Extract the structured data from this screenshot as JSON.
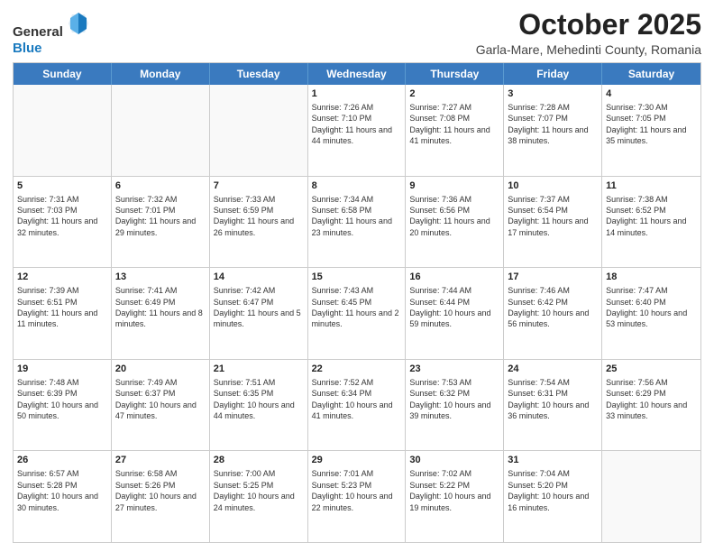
{
  "header": {
    "logo": {
      "line1": "General",
      "line2": "Blue"
    },
    "title": "October 2025",
    "location": "Garla-Mare, Mehedinti County, Romania"
  },
  "weekdays": [
    "Sunday",
    "Monday",
    "Tuesday",
    "Wednesday",
    "Thursday",
    "Friday",
    "Saturday"
  ],
  "rows": [
    [
      {
        "day": "",
        "sunrise": "",
        "sunset": "",
        "daylight": ""
      },
      {
        "day": "",
        "sunrise": "",
        "sunset": "",
        "daylight": ""
      },
      {
        "day": "",
        "sunrise": "",
        "sunset": "",
        "daylight": ""
      },
      {
        "day": "1",
        "sunrise": "Sunrise: 7:26 AM",
        "sunset": "Sunset: 7:10 PM",
        "daylight": "Daylight: 11 hours and 44 minutes."
      },
      {
        "day": "2",
        "sunrise": "Sunrise: 7:27 AM",
        "sunset": "Sunset: 7:08 PM",
        "daylight": "Daylight: 11 hours and 41 minutes."
      },
      {
        "day": "3",
        "sunrise": "Sunrise: 7:28 AM",
        "sunset": "Sunset: 7:07 PM",
        "daylight": "Daylight: 11 hours and 38 minutes."
      },
      {
        "day": "4",
        "sunrise": "Sunrise: 7:30 AM",
        "sunset": "Sunset: 7:05 PM",
        "daylight": "Daylight: 11 hours and 35 minutes."
      }
    ],
    [
      {
        "day": "5",
        "sunrise": "Sunrise: 7:31 AM",
        "sunset": "Sunset: 7:03 PM",
        "daylight": "Daylight: 11 hours and 32 minutes."
      },
      {
        "day": "6",
        "sunrise": "Sunrise: 7:32 AM",
        "sunset": "Sunset: 7:01 PM",
        "daylight": "Daylight: 11 hours and 29 minutes."
      },
      {
        "day": "7",
        "sunrise": "Sunrise: 7:33 AM",
        "sunset": "Sunset: 6:59 PM",
        "daylight": "Daylight: 11 hours and 26 minutes."
      },
      {
        "day": "8",
        "sunrise": "Sunrise: 7:34 AM",
        "sunset": "Sunset: 6:58 PM",
        "daylight": "Daylight: 11 hours and 23 minutes."
      },
      {
        "day": "9",
        "sunrise": "Sunrise: 7:36 AM",
        "sunset": "Sunset: 6:56 PM",
        "daylight": "Daylight: 11 hours and 20 minutes."
      },
      {
        "day": "10",
        "sunrise": "Sunrise: 7:37 AM",
        "sunset": "Sunset: 6:54 PM",
        "daylight": "Daylight: 11 hours and 17 minutes."
      },
      {
        "day": "11",
        "sunrise": "Sunrise: 7:38 AM",
        "sunset": "Sunset: 6:52 PM",
        "daylight": "Daylight: 11 hours and 14 minutes."
      }
    ],
    [
      {
        "day": "12",
        "sunrise": "Sunrise: 7:39 AM",
        "sunset": "Sunset: 6:51 PM",
        "daylight": "Daylight: 11 hours and 11 minutes."
      },
      {
        "day": "13",
        "sunrise": "Sunrise: 7:41 AM",
        "sunset": "Sunset: 6:49 PM",
        "daylight": "Daylight: 11 hours and 8 minutes."
      },
      {
        "day": "14",
        "sunrise": "Sunrise: 7:42 AM",
        "sunset": "Sunset: 6:47 PM",
        "daylight": "Daylight: 11 hours and 5 minutes."
      },
      {
        "day": "15",
        "sunrise": "Sunrise: 7:43 AM",
        "sunset": "Sunset: 6:45 PM",
        "daylight": "Daylight: 11 hours and 2 minutes."
      },
      {
        "day": "16",
        "sunrise": "Sunrise: 7:44 AM",
        "sunset": "Sunset: 6:44 PM",
        "daylight": "Daylight: 10 hours and 59 minutes."
      },
      {
        "day": "17",
        "sunrise": "Sunrise: 7:46 AM",
        "sunset": "Sunset: 6:42 PM",
        "daylight": "Daylight: 10 hours and 56 minutes."
      },
      {
        "day": "18",
        "sunrise": "Sunrise: 7:47 AM",
        "sunset": "Sunset: 6:40 PM",
        "daylight": "Daylight: 10 hours and 53 minutes."
      }
    ],
    [
      {
        "day": "19",
        "sunrise": "Sunrise: 7:48 AM",
        "sunset": "Sunset: 6:39 PM",
        "daylight": "Daylight: 10 hours and 50 minutes."
      },
      {
        "day": "20",
        "sunrise": "Sunrise: 7:49 AM",
        "sunset": "Sunset: 6:37 PM",
        "daylight": "Daylight: 10 hours and 47 minutes."
      },
      {
        "day": "21",
        "sunrise": "Sunrise: 7:51 AM",
        "sunset": "Sunset: 6:35 PM",
        "daylight": "Daylight: 10 hours and 44 minutes."
      },
      {
        "day": "22",
        "sunrise": "Sunrise: 7:52 AM",
        "sunset": "Sunset: 6:34 PM",
        "daylight": "Daylight: 10 hours and 41 minutes."
      },
      {
        "day": "23",
        "sunrise": "Sunrise: 7:53 AM",
        "sunset": "Sunset: 6:32 PM",
        "daylight": "Daylight: 10 hours and 39 minutes."
      },
      {
        "day": "24",
        "sunrise": "Sunrise: 7:54 AM",
        "sunset": "Sunset: 6:31 PM",
        "daylight": "Daylight: 10 hours and 36 minutes."
      },
      {
        "day": "25",
        "sunrise": "Sunrise: 7:56 AM",
        "sunset": "Sunset: 6:29 PM",
        "daylight": "Daylight: 10 hours and 33 minutes."
      }
    ],
    [
      {
        "day": "26",
        "sunrise": "Sunrise: 6:57 AM",
        "sunset": "Sunset: 5:28 PM",
        "daylight": "Daylight: 10 hours and 30 minutes."
      },
      {
        "day": "27",
        "sunrise": "Sunrise: 6:58 AM",
        "sunset": "Sunset: 5:26 PM",
        "daylight": "Daylight: 10 hours and 27 minutes."
      },
      {
        "day": "28",
        "sunrise": "Sunrise: 7:00 AM",
        "sunset": "Sunset: 5:25 PM",
        "daylight": "Daylight: 10 hours and 24 minutes."
      },
      {
        "day": "29",
        "sunrise": "Sunrise: 7:01 AM",
        "sunset": "Sunset: 5:23 PM",
        "daylight": "Daylight: 10 hours and 22 minutes."
      },
      {
        "day": "30",
        "sunrise": "Sunrise: 7:02 AM",
        "sunset": "Sunset: 5:22 PM",
        "daylight": "Daylight: 10 hours and 19 minutes."
      },
      {
        "day": "31",
        "sunrise": "Sunrise: 7:04 AM",
        "sunset": "Sunset: 5:20 PM",
        "daylight": "Daylight: 10 hours and 16 minutes."
      },
      {
        "day": "",
        "sunrise": "",
        "sunset": "",
        "daylight": ""
      }
    ]
  ]
}
